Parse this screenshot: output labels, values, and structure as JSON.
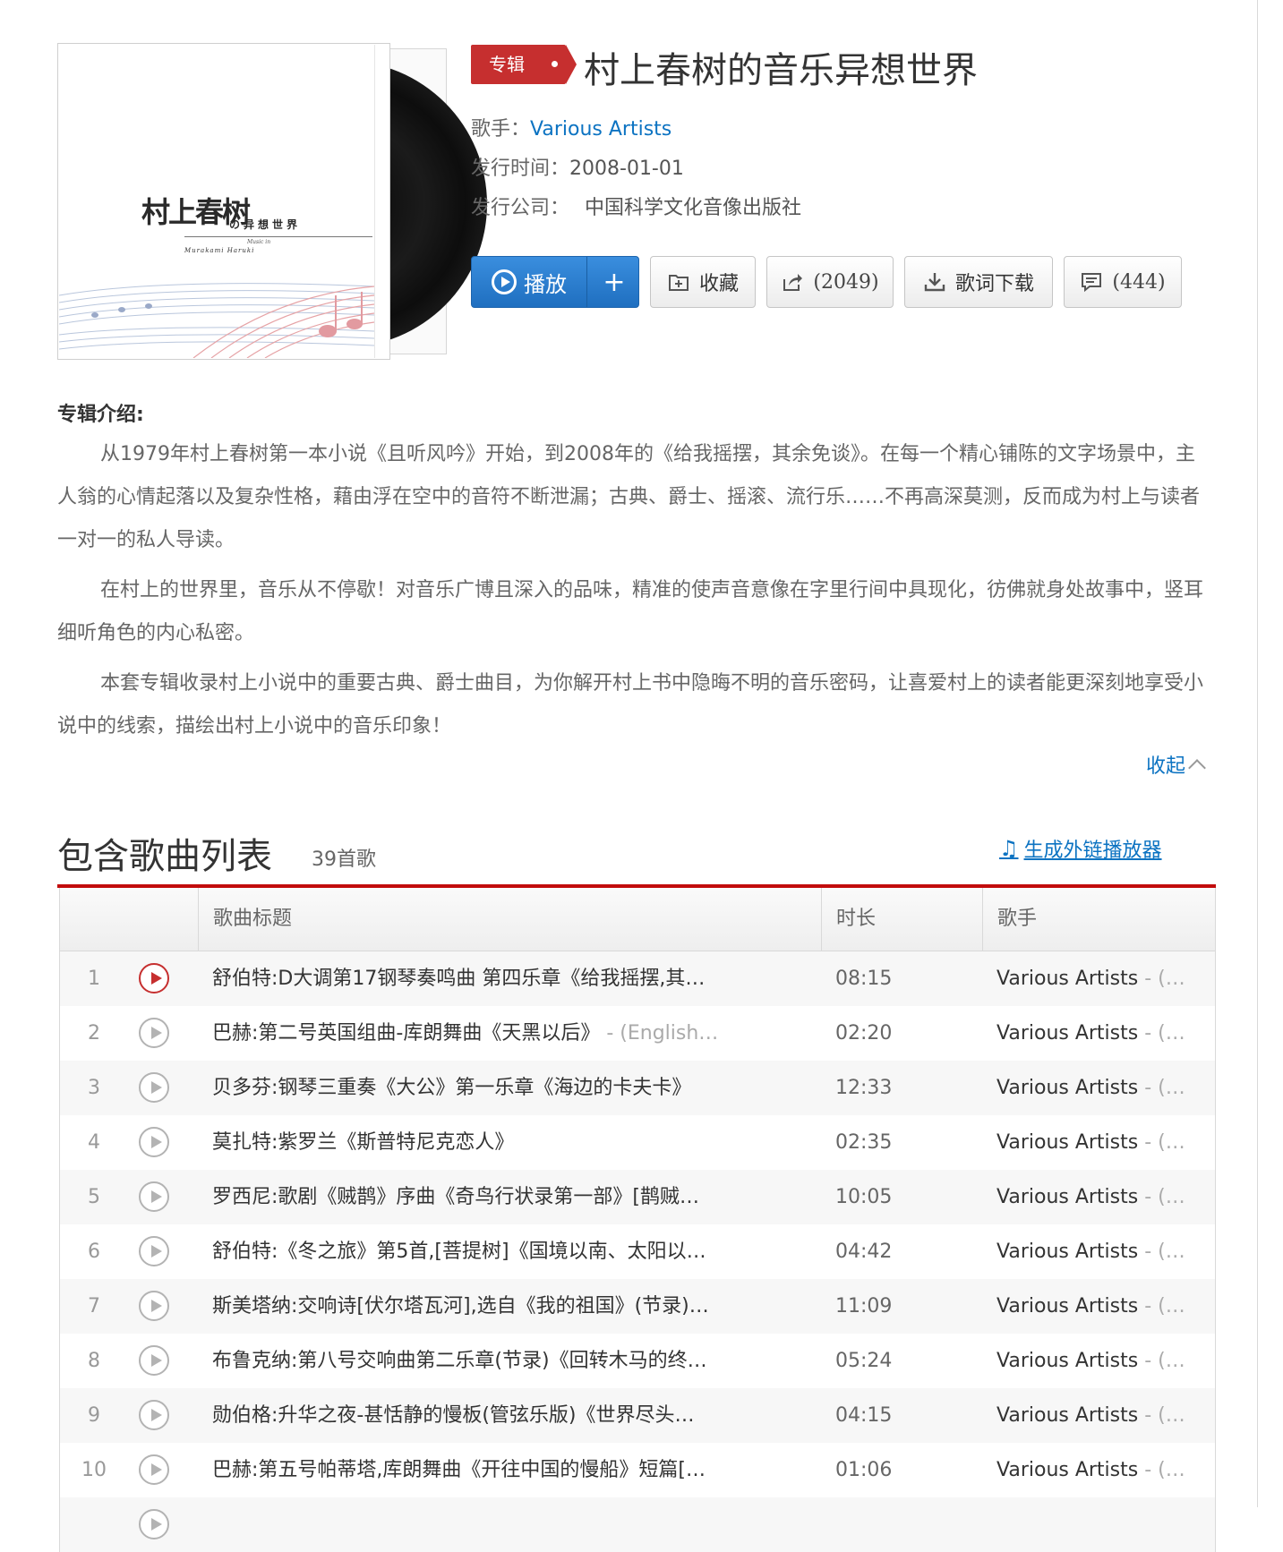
{
  "album": {
    "badge": "专辑",
    "title": "村上春树的音乐异想世界",
    "cover": {
      "title": "村上春树",
      "subtitle": "の异想世界",
      "english_1": "Music in",
      "english_2": "Murakami Haruki"
    },
    "artist_label": "歌手：",
    "artist": "Various Artists",
    "release_label": "发行时间：",
    "release_date": "2008-01-01",
    "company_label": "发行公司：",
    "company": "中国科学文化音像出版社"
  },
  "actions": {
    "play": "播放",
    "add": "+",
    "collect": "收藏",
    "share_count": "(2049)",
    "lyrics_download": "歌词下载",
    "comment_count": "(444)"
  },
  "intro": {
    "heading": "专辑介绍:",
    "paragraphs": [
      "从1979年村上春树第一本小说《且听风吟》开始，到2008年的《给我摇摆，其余免谈》。在每一个精心铺陈的文字场景中，主人翁的心情起落以及复杂性格，藉由浮在空中的音符不断泄漏；古典、爵士、摇滚、流行乐……不再高深莫测，反而成为村上与读者一对一的私人导读。",
      "在村上的世界里，音乐从不停歇！对音乐广博且深入的品味，精准的使声音意像在字里行间中具现化，彷佛就身处故事中，竖耳细听角色的内心私密。",
      "本套专辑收录村上小说中的重要古典、爵士曲目，为你解开村上书中隐晦不明的音乐密码，让喜爱村上的读者能更深刻地享受小说中的线索，描绘出村上小说中的音乐印象！"
    ],
    "collapse": "收起"
  },
  "tracklist": {
    "title": "包含歌曲列表",
    "count": "39首歌",
    "generate_link": "生成外链播放器",
    "columns": {
      "title": "歌曲标题",
      "duration": "时长",
      "artist": "歌手"
    },
    "rows": [
      {
        "num": "1",
        "title": "舒伯特:D大调第17钢琴奏鸣曲 第四乐章《给我摇摆,其…",
        "alias": "",
        "duration": "08:15",
        "artist": "Various Artists",
        "artist_alias": " - (…"
      },
      {
        "num": "2",
        "title": "巴赫:第二号英国组曲-库朗舞曲《天黑以后》",
        "alias": " - (English…",
        "duration": "02:20",
        "artist": "Various Artists",
        "artist_alias": " - (…"
      },
      {
        "num": "3",
        "title": "贝多芬:钢琴三重奏《大公》第一乐章《海边的卡夫卡》",
        "alias": "",
        "duration": "12:33",
        "artist": "Various Artists",
        "artist_alias": " - (…"
      },
      {
        "num": "4",
        "title": "莫扎特:紫罗兰《斯普特尼克恋人》",
        "alias": "",
        "duration": "02:35",
        "artist": "Various Artists",
        "artist_alias": " - (…"
      },
      {
        "num": "5",
        "title": "罗西尼:歌剧《贼鹊》序曲《奇鸟行状录第一部》[鹊贼…",
        "alias": "",
        "duration": "10:05",
        "artist": "Various Artists",
        "artist_alias": " - (…"
      },
      {
        "num": "6",
        "title": "舒伯特:《冬之旅》第5首,[菩提树]《国境以南、太阳以…",
        "alias": "",
        "duration": "04:42",
        "artist": "Various Artists",
        "artist_alias": " - (…"
      },
      {
        "num": "7",
        "title": "斯美塔纳:交响诗[伏尔塔瓦河],选自《我的祖国》(节录)…",
        "alias": "",
        "duration": "11:09",
        "artist": "Various Artists",
        "artist_alias": " - (…"
      },
      {
        "num": "8",
        "title": "布鲁克纳:第八号交响曲第二乐章(节录)《回转木马的终…",
        "alias": "",
        "duration": "05:24",
        "artist": "Various Artists",
        "artist_alias": " - (…"
      },
      {
        "num": "9",
        "title": "勋伯格:升华之夜-甚恬静的慢板(管弦乐版)《世界尽头…",
        "alias": "",
        "duration": "04:15",
        "artist": "Various Artists",
        "artist_alias": " - (…"
      },
      {
        "num": "10",
        "title": "巴赫:第五号帕蒂塔,库朗舞曲《开往中国的慢船》短篇[…",
        "alias": "",
        "duration": "01:06",
        "artist": "Various Artists",
        "artist_alias": " - (…"
      }
    ]
  },
  "colors": {
    "brand_red": "#c62f2f",
    "link_blue": "#0c73c2",
    "play_blue": "#2b7fd3"
  }
}
